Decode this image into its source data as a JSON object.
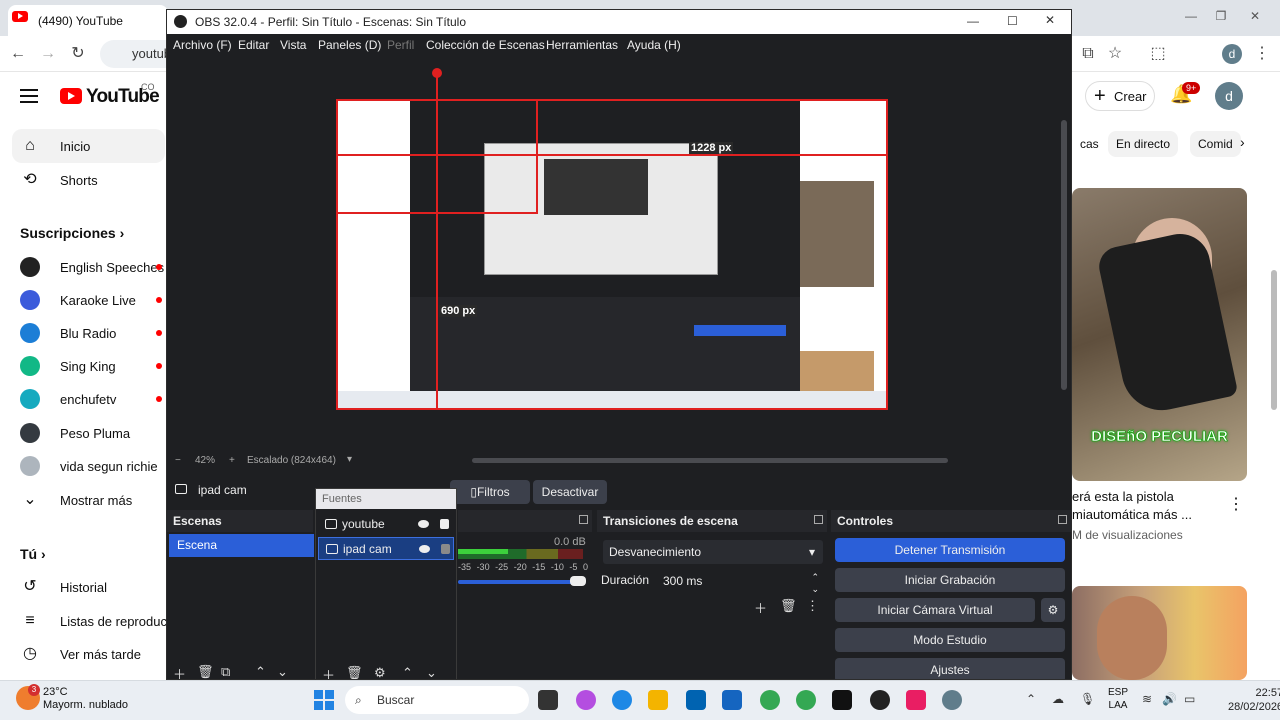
{
  "browser": {
    "tab_title": "(4490) YouTube",
    "url_fragment": "youtub",
    "window_controls": [
      "—",
      "❐",
      "✕"
    ]
  },
  "youtube": {
    "logo_text": "YouTube",
    "country": "CO",
    "nav": [
      {
        "label": "Inicio",
        "icon": "home-icon"
      },
      {
        "label": "Shorts",
        "icon": "shorts-icon"
      }
    ],
    "subscriptions_title": "Suscripciones",
    "subscriptions": [
      {
        "label": "English Speeches",
        "color": "#222222"
      },
      {
        "label": "Karaoke Live",
        "color": "#3b5bdb"
      },
      {
        "label": "Blu Radio",
        "color": "#1c7ed6"
      },
      {
        "label": "Sing King",
        "color": "#12b886"
      },
      {
        "label": "enchufetv",
        "color": "#15aabf"
      },
      {
        "label": "Peso Pluma",
        "color": "#343a40"
      },
      {
        "label": "vida segun richie",
        "color": "#adb5bd"
      }
    ],
    "show_more": "Mostrar más",
    "you_title": "Tú",
    "you_items": [
      {
        "label": "Historial",
        "icon": "history-icon"
      },
      {
        "label": "Listas de reproducc...",
        "icon": "playlist-icon"
      },
      {
        "label": "Ver más tarde",
        "icon": "clock-icon"
      }
    ],
    "create_label": "Crear",
    "notif_count": "9+",
    "user_initial": "d",
    "chips": [
      "cas",
      "En directo",
      "Comid"
    ],
    "thumb_caption": "DISEñO PECULIAR",
    "video_title": "erá esta la pistola miautomática más ...",
    "video_meta": "M de visualizaciones"
  },
  "obs": {
    "title": "OBS 32.0.4 - Perfil: Sin Título - Escenas: Sin Título",
    "menu": [
      "Archivo (F)",
      "Editar",
      "Vista",
      "Paneles (D)",
      "Perfil",
      "Colección de Escenas",
      "Herramientas",
      "Ayuda (H)"
    ],
    "zoom": "42%",
    "scaling": "Escalado (824x464)",
    "px_width": "1228 px",
    "px_height": "690 px",
    "source_name": "ipad cam",
    "filters_label": "Filtros",
    "deactivate_label": "Desactivar",
    "scenes_title": "Escenas",
    "scene_item": "Escena",
    "sources_title": "Fuentes",
    "sources": [
      "youtube",
      "ipad cam"
    ],
    "mixer_db": "0.0 dB",
    "mixer_ticks": [
      "-35",
      "-30",
      "-25",
      "-20",
      "-15",
      "-10",
      "-5",
      "0"
    ],
    "transitions_title": "Transiciones de escena",
    "transition": "Desvanecimiento",
    "duration_label": "Duración",
    "duration_value": "300 ms",
    "controls_title": "Controles",
    "controls": [
      "Detener Transmisión",
      "Iniciar Grabación",
      "Iniciar Cámara Virtual",
      "Modo Estudio",
      "Ajustes"
    ]
  },
  "taskbar": {
    "weather_temp": "23°C",
    "weather_desc": "Mayorm. nublado",
    "weather_badge": "3",
    "search_label": "Buscar",
    "lang_1": "ESP",
    "lang_2": "LAA",
    "time": "22:57",
    "date": "28/02/2026"
  }
}
